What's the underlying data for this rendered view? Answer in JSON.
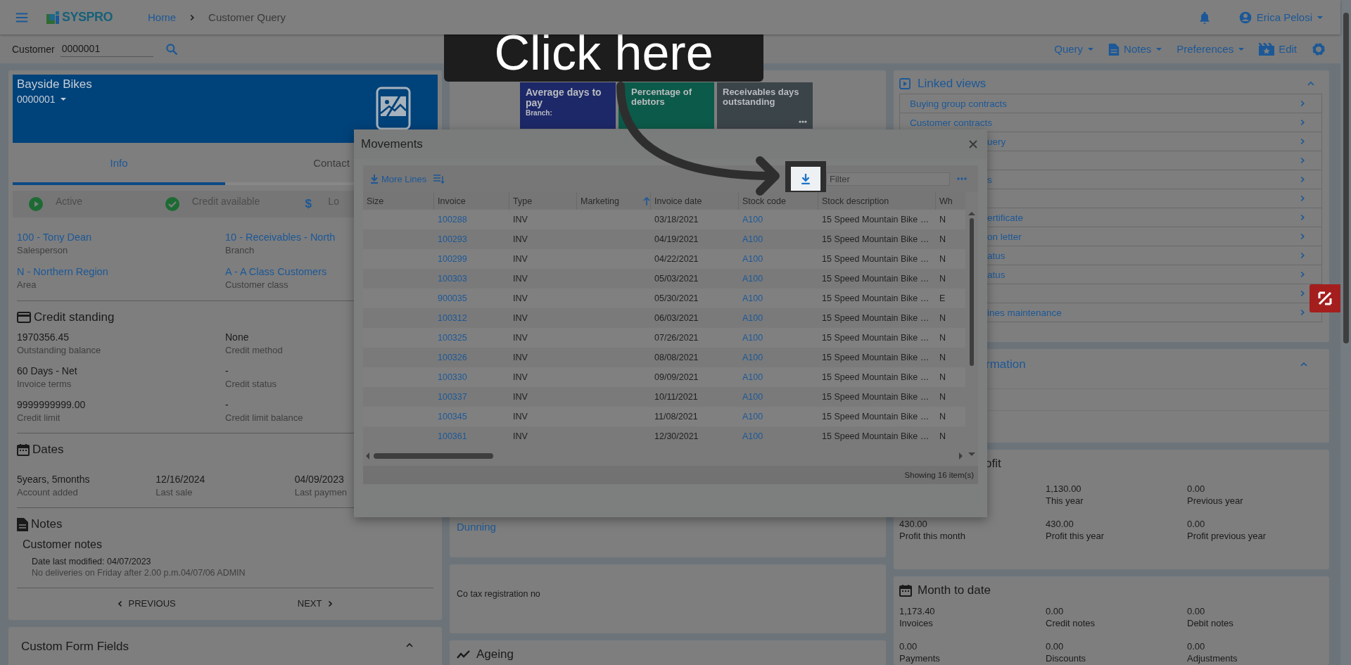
{
  "header": {
    "logo": "SYSPRO",
    "breadcrumbs": [
      {
        "label": "Home",
        "kind": "link"
      },
      {
        "label": "Customer Query",
        "kind": "current"
      }
    ],
    "user": "Erica Pelosi"
  },
  "customer_field": {
    "label": "Customer",
    "value": "0000001"
  },
  "actions": [
    {
      "label": "Query",
      "kind": "menu"
    },
    {
      "label": "Notes",
      "kind": "notes"
    },
    {
      "label": "Preferences",
      "kind": "menu"
    },
    {
      "label": "Edit",
      "kind": "edit"
    }
  ],
  "customer_card": {
    "name": "Bayside Bikes",
    "code": "0000001",
    "tabs": [
      {
        "label": "Info",
        "selected": true
      },
      {
        "label": "Contact",
        "selected": false
      }
    ],
    "statuses": [
      {
        "label": "Active",
        "kind": "active"
      },
      {
        "label": "Credit available",
        "kind": "check"
      },
      {
        "label": "Lo",
        "kind": "money",
        "icon_text": "$"
      }
    ],
    "fields": [
      {
        "value": "100 - Tony Dean",
        "label": "Salesperson"
      },
      {
        "value": "10 - Receivables - North",
        "label": "Branch"
      },
      {
        "value": "N - Northern Region",
        "label": "Area"
      },
      {
        "value": "A - A Class Customers",
        "label": "Customer class"
      }
    ],
    "credit_standing": {
      "title": "Credit standing",
      "fields": [
        {
          "value": "1970356.45",
          "label": "Outstanding balance"
        },
        {
          "value": "None",
          "label": "Credit method"
        },
        {
          "value": "60 Days - Net",
          "label": "Invoice terms"
        },
        {
          "value": "-",
          "label": "Credit status"
        },
        {
          "value": "9999999999.00",
          "label": "Credit limit"
        },
        {
          "value": "-",
          "label": "Credit limit balance"
        }
      ]
    },
    "dates": {
      "title": "Dates",
      "fields": [
        {
          "value": "5years, 5months",
          "label": "Account added"
        },
        {
          "value": "12/16/2024",
          "label": "Last sale"
        },
        {
          "value": "04/09/2023",
          "label": "Last paymen"
        }
      ]
    },
    "notes": {
      "title": "Notes",
      "subtitle": "Customer notes",
      "modified": "Date last modified: 04/07/2023",
      "text": "No deliveries on Friday after 2.00 p.m.04/07/06 ADMIN"
    },
    "nav": {
      "previous": "PREVIOUS",
      "next": "NEXT"
    }
  },
  "custom_form_fields": {
    "title": "Custom Form Fields",
    "expanded": true
  },
  "kpi_tiles": [
    {
      "title": "Average days to pay",
      "subtitle": "Branch:",
      "color": "#1d2868"
    },
    {
      "title": "Percentage of debtors",
      "color": "#0c5a49"
    },
    {
      "title": "Receivables days outstanding",
      "color": "#3b4449",
      "more": true
    }
  ],
  "middle_cards": [
    {
      "kind": "link",
      "text": "Dunning"
    },
    {
      "kind": "text",
      "text": "Co tax registration no"
    },
    {
      "kind": "heading",
      "text": "Ageing"
    }
  ],
  "linked_views": {
    "title": "Linked views",
    "expanded": true,
    "items": [
      {
        "label": "Buying group contracts",
        "kind": "full"
      },
      {
        "label": "Customer contracts",
        "kind": "full"
      },
      {
        "label": "uery",
        "kind": "covered"
      },
      {
        "kind": "covered"
      },
      {
        "label": "s",
        "kind": "covered"
      },
      {
        "kind": "covered"
      },
      {
        "label": "ertificate",
        "kind": "covered"
      },
      {
        "label": "on letter",
        "kind": "covered"
      },
      {
        "label": "atus",
        "kind": "covered"
      },
      {
        "label": "atus",
        "kind": "covered"
      },
      {
        "kind": "covered"
      },
      {
        "label": "ines maintenance",
        "kind": "covered"
      }
    ]
  },
  "customer_information": {
    "title": "rmation",
    "expanded": true
  },
  "profit": {
    "title": "ofit",
    "values": [
      {
        "value": "1,130.00",
        "label": "This year"
      },
      {
        "value": "0.00",
        "label": "Previous year"
      },
      {
        "value": "430.00",
        "label": "Profit this month"
      },
      {
        "value": "430.00",
        "label": "Profit this year"
      },
      {
        "value": "0.00",
        "label": "Profit previous year"
      }
    ]
  },
  "month_to_date": {
    "title": "Month to date",
    "values": [
      {
        "value": "1,173.40",
        "label": "Invoices"
      },
      {
        "value": "0.00",
        "label": "Credit notes"
      },
      {
        "value": "0.00",
        "label": "Debit notes"
      },
      {
        "value": "0.00",
        "label": "Payments"
      },
      {
        "value": "0.00",
        "label": "Discounts"
      },
      {
        "value": "0.00",
        "label": "Adjustments"
      }
    ]
  },
  "dialog": {
    "title": "Movements",
    "more_lines": "More Lines",
    "filter_placeholder": "Filter",
    "columns": [
      {
        "label": "Size"
      },
      {
        "label": "Invoice"
      },
      {
        "label": "Type"
      },
      {
        "label": "Marketing",
        "sort_ascending": true
      },
      {
        "label": "Invoice date"
      },
      {
        "label": "Stock code"
      },
      {
        "label": "Stock description"
      },
      {
        "label": "Wh"
      }
    ],
    "rows": [
      {
        "invoice": "100288",
        "type": "INV",
        "invoice_date": "03/18/2021",
        "stock_code": "A100",
        "stock_description": "15 Speed Mountain Bike …",
        "wh": "N"
      },
      {
        "invoice": "100293",
        "type": "INV",
        "invoice_date": "04/19/2021",
        "stock_code": "A100",
        "stock_description": "15 Speed Mountain Bike …",
        "wh": "N"
      },
      {
        "invoice": "100299",
        "type": "INV",
        "invoice_date": "04/22/2021",
        "stock_code": "A100",
        "stock_description": "15 Speed Mountain Bike …",
        "wh": "N"
      },
      {
        "invoice": "100303",
        "type": "INV",
        "invoice_date": "05/03/2021",
        "stock_code": "A100",
        "stock_description": "15 Speed Mountain Bike …",
        "wh": "N"
      },
      {
        "invoice": "900035",
        "type": "INV",
        "invoice_date": "05/30/2021",
        "stock_code": "A100",
        "stock_description": "15 Speed Mountain Bike …",
        "wh": "E"
      },
      {
        "invoice": "100312",
        "type": "INV",
        "invoice_date": "06/03/2021",
        "stock_code": "A100",
        "stock_description": "15 Speed Mountain Bike …",
        "wh": "N"
      },
      {
        "invoice": "100325",
        "type": "INV",
        "invoice_date": "07/26/2021",
        "stock_code": "A100",
        "stock_description": "15 Speed Mountain Bike …",
        "wh": "N"
      },
      {
        "invoice": "100326",
        "type": "INV",
        "invoice_date": "08/08/2021",
        "stock_code": "A100",
        "stock_description": "15 Speed Mountain Bike …",
        "wh": "N"
      },
      {
        "invoice": "100330",
        "type": "INV",
        "invoice_date": "09/09/2021",
        "stock_code": "A100",
        "stock_description": "15 Speed Mountain Bike …",
        "wh": "N"
      },
      {
        "invoice": "100337",
        "type": "INV",
        "invoice_date": "10/11/2021",
        "stock_code": "A100",
        "stock_description": "15 Speed Mountain Bike …",
        "wh": "N"
      },
      {
        "invoice": "100345",
        "type": "INV",
        "invoice_date": "11/08/2021",
        "stock_code": "A100",
        "stock_description": "15 Speed Mountain Bike …",
        "wh": "N"
      },
      {
        "invoice": "100361",
        "type": "INV",
        "invoice_date": "12/30/2021",
        "stock_code": "A100",
        "stock_description": "15 Speed Mountain Bike …",
        "wh": "N"
      }
    ],
    "footer": "Showing 16 item(s)"
  },
  "tutorial": {
    "callout": "Click here"
  }
}
